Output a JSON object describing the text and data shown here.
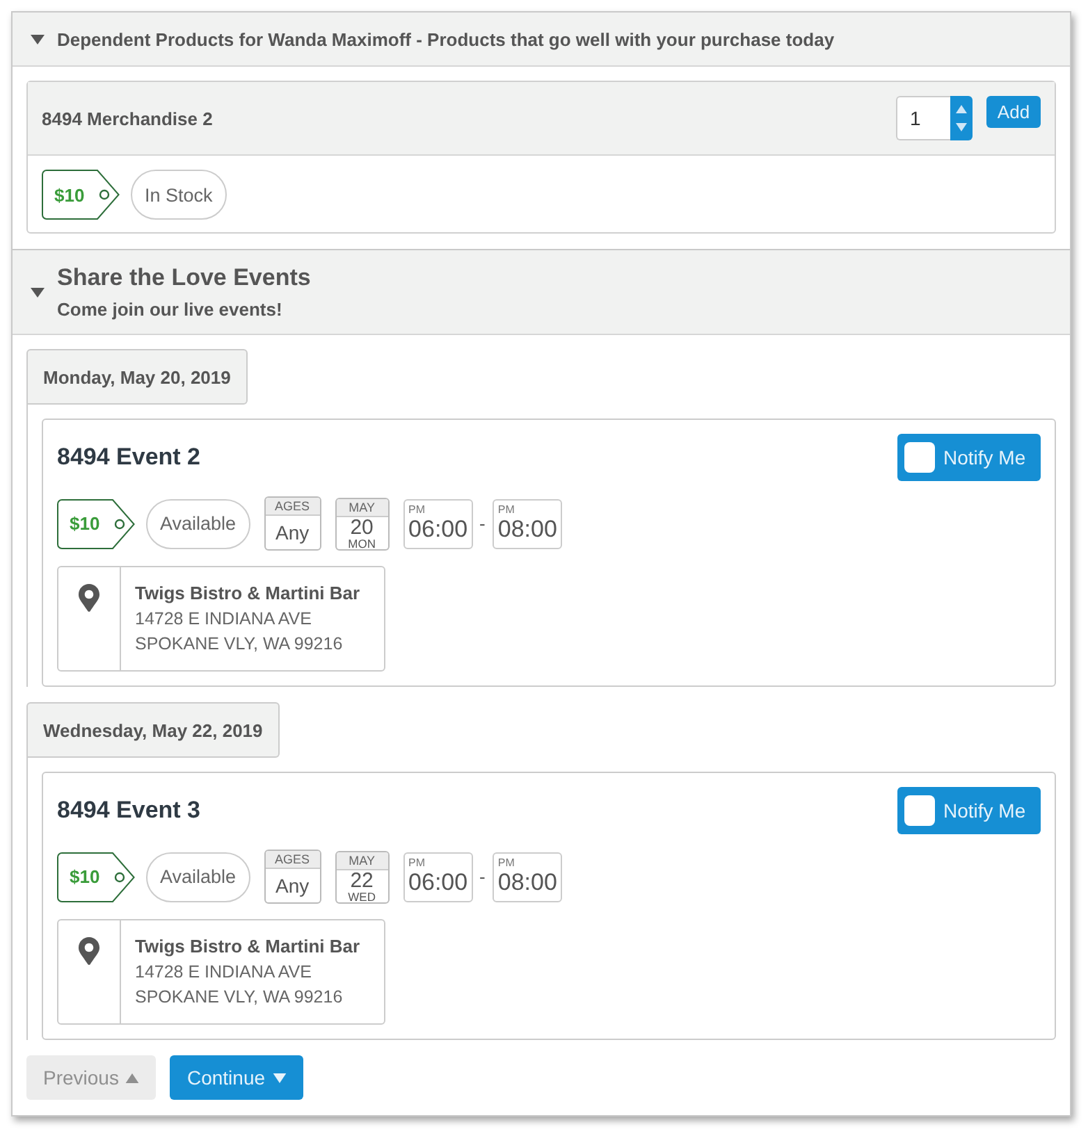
{
  "product_section": {
    "title": "Dependent Products for Wanda Maximoff - Products that go well with your purchase today",
    "expanded": true,
    "products": [
      {
        "name": "8494 Merchandise 2",
        "quantity": "1",
        "add_label": "Add",
        "price": "$10",
        "stock": "In Stock"
      }
    ]
  },
  "events_section": {
    "title": "Share the Love Events",
    "subtitle": "Come join our live events!",
    "expanded": true,
    "days": [
      {
        "date": "Monday, May 20, 2019",
        "events": [
          {
            "name": "8494 Event 2",
            "notify_label": "Notify Me",
            "notify_checked": false,
            "price": "$10",
            "availability": "Available",
            "ages_label": "AGES",
            "ages": "Any",
            "month": "MAY",
            "day": "20",
            "weekday": "MON",
            "start_period": "PM",
            "start_time": "06:00",
            "separator": "-",
            "end_period": "PM",
            "end_time": "08:00",
            "venue": "Twigs Bistro & Martini Bar",
            "address_lines": [
              "14728 E INDIANA AVE",
              "SPOKANE VLY, WA 99216"
            ]
          }
        ]
      },
      {
        "date": "Wednesday, May 22, 2019",
        "events": [
          {
            "name": "8494 Event 3",
            "notify_label": "Notify Me",
            "notify_checked": false,
            "price": "$10",
            "availability": "Available",
            "ages_label": "AGES",
            "ages": "Any",
            "month": "MAY",
            "day": "22",
            "weekday": "WED",
            "start_period": "PM",
            "start_time": "06:00",
            "separator": "-",
            "end_period": "PM",
            "end_time": "08:00",
            "venue": "Twigs Bistro & Martini Bar",
            "address_lines": [
              "14728 E INDIANA AVE",
              "SPOKANE VLY, WA 99216"
            ]
          }
        ]
      }
    ]
  },
  "navigation": [
    {
      "label": "Previous",
      "kind": "back",
      "disabled": true
    },
    {
      "label": "Continue",
      "kind": "next",
      "disabled": false
    }
  ]
}
